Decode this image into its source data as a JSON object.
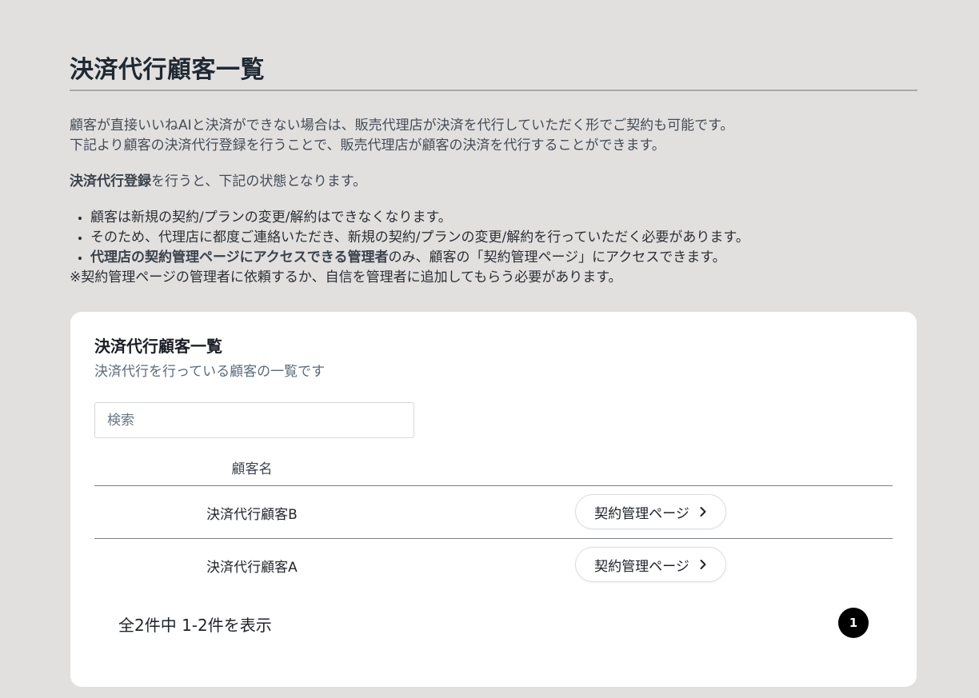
{
  "page": {
    "title": "決済代行顧客一覧",
    "intro_line1": "顧客が直接いいねAIと決済ができない場合は、販売代理店が決済を代行していただく形でご契約も可能です。",
    "intro_line2": "下記より顧客の決済代行登録を行うことで、販売代理店が顧客の決済を代行することができます。",
    "state_bold": "決済代行登録",
    "state_rest": "を行うと、下記の状態となります。",
    "bullets": [
      {
        "text": "顧客は新規の契約/プランの変更/解約はできなくなります。"
      },
      {
        "text": "そのため、代理店に都度ご連絡いただき、新規の契約/プランの変更/解約を行っていただく必要があります。"
      },
      {
        "bold": "代理店の契約管理ページにアクセスできる管理者",
        "text": "のみ、顧客の「契約管理ページ」にアクセスできます。"
      }
    ],
    "note": "※契約管理ページの管理者に依頼するか、自信を管理者に追加してもらう必要があります。"
  },
  "card": {
    "title": "決済代行顧客一覧",
    "subtitle": "決済代行を行っている顧客の一覧です",
    "search_placeholder": "検索",
    "search_value": "",
    "table": {
      "header_name": "顧客名",
      "rows": [
        {
          "name": "決済代行顧客B",
          "button_label": "契約管理ページ"
        },
        {
          "name": "決済代行顧客A",
          "button_label": "契約管理ページ"
        }
      ]
    },
    "pagination": {
      "summary": "全2件中 1-2件を表示",
      "current_page": "1"
    }
  },
  "icons": {
    "row_button_icon": "chevron-right-icon"
  },
  "colors": {
    "background": "#e2e0df",
    "card": "#ffffff",
    "pagination_active": "#000000"
  }
}
